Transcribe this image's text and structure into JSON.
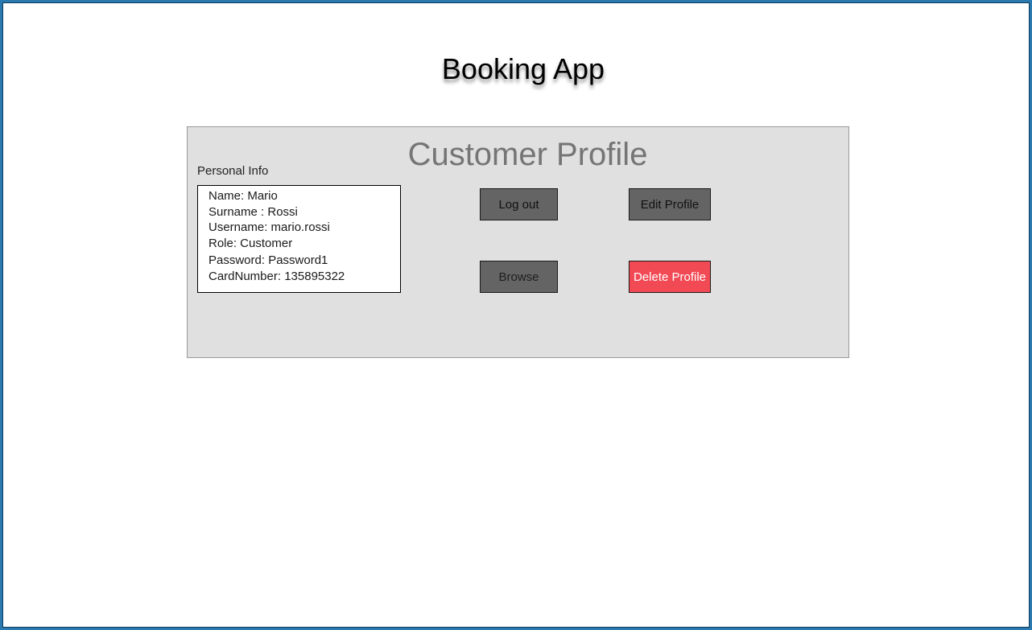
{
  "app": {
    "title": "Booking App"
  },
  "profile": {
    "title": "Customer Profile",
    "section_label": "Personal Info",
    "info_lines": [
      "Name: Mario",
      "Surname : Rossi",
      "Username: mario.rossi",
      "Role: Customer",
      "Password: Password1",
      "CardNumber: 135895322"
    ]
  },
  "actions": {
    "logout_label": "Log out",
    "edit_label": "Edit Profile",
    "browse_label": "Browse",
    "delete_label": "Delete Profile"
  },
  "colors": {
    "frame_border": "#2a7ab0",
    "panel_background": "#e0e0e0",
    "button_background": "#646464",
    "delete_background": "#f24a55"
  }
}
